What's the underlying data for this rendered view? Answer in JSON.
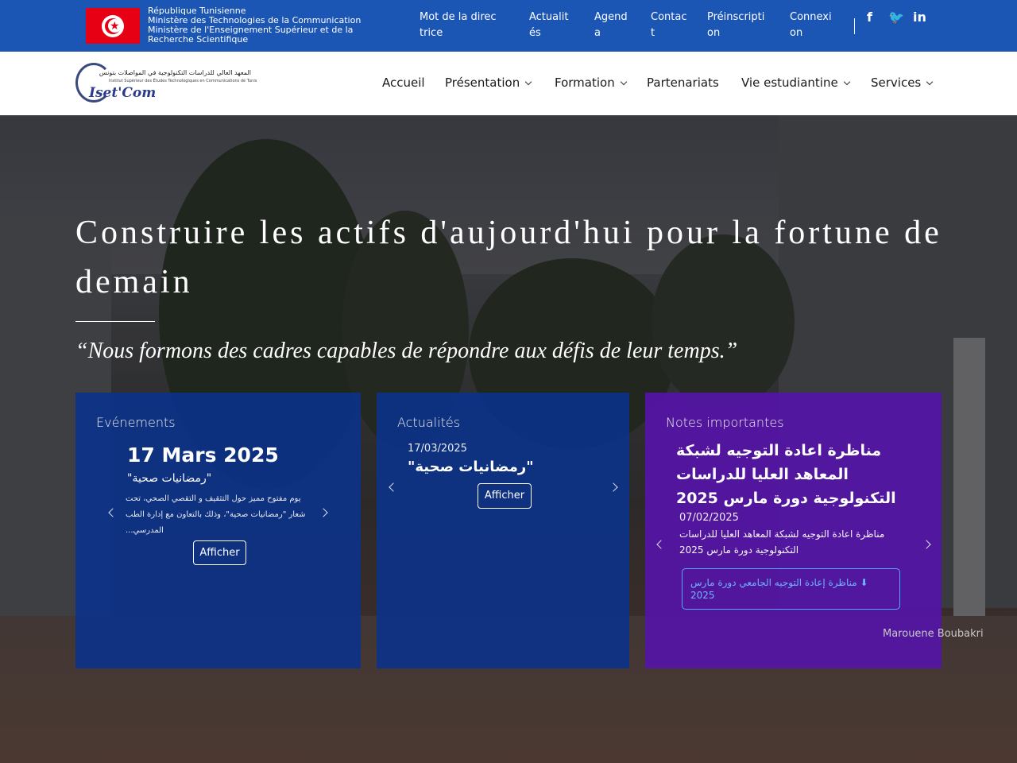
{
  "topbar": {
    "gov_lines": [
      "République Tunisienne",
      "Ministère des Technologies de la Communication",
      "Ministère de l'Enseignement Supérieur et de la Recherche Scientifique"
    ],
    "links": [
      "Mot de la directrice",
      "Actualités",
      "Agenda",
      "Contact",
      "Préinscription",
      "Connexion"
    ],
    "social_icons": [
      "facebook-icon",
      "twitter-icon",
      "linkedin-icon"
    ],
    "social_glyphs": [
      "f",
      "🐦",
      "in"
    ]
  },
  "logo": {
    "arabic": "المعهد العالي للدراسات التكنولوجية في المواصلات بتونس",
    "french": "Institut Supérieur des Études Technologiques en Communications de Tunis",
    "name": "Iset'Com"
  },
  "nav": {
    "items": [
      {
        "label": "Accueil",
        "dropdown": false
      },
      {
        "label": "Présentation",
        "dropdown": true
      },
      {
        "label": "Formation",
        "dropdown": true
      },
      {
        "label": "Partenariats",
        "dropdown": false
      },
      {
        "label": "Vie estudiantine",
        "dropdown": true
      },
      {
        "label": "Services",
        "dropdown": true
      }
    ]
  },
  "hero": {
    "headline": "Construire les actifs d'aujourd'hui pour la fortune de demain",
    "quote": "“Nous formons des cadres capables de répondre aux défis de leur temps.”",
    "photo_credit": "Marouene Boubakri"
  },
  "cards": {
    "events": {
      "title": "Evénements",
      "date": "17 Mars 2025",
      "subtitle": "\"رمضانيات صحية\"",
      "description": "يوم مفتوح مميز حول التثقيف و التقصي الصحي، تحت شعار \"رمضانيات صحية\"، وذلك بالتعاون مع إدارة الطب المدرسي...",
      "button": "Afficher"
    },
    "news": {
      "title": "Actualités",
      "date": "17/03/2025",
      "headline": "\"رمضانيات صحية\"",
      "button": "Afficher"
    },
    "notes": {
      "title": "Notes importantes",
      "headline": "مناظرة اعادة التوجيه لشبكة المعاهد العليا للدراسات التكنولوجية دورة مارس 2025",
      "date": "07/02/2025",
      "description": "مناظرة اعادة التوجيه لشبكة المعاهد العليا للدراسات التكنولوجية دورة مارس 2025",
      "download": "مناظرة إعادة التوجيه الجامعي دورة مارس 2025"
    }
  },
  "colors": {
    "topbar": "#1c56b5",
    "card_blue": "#0a328c",
    "card_purple": "#5514aa",
    "download_accent": "#6fb3ff"
  }
}
